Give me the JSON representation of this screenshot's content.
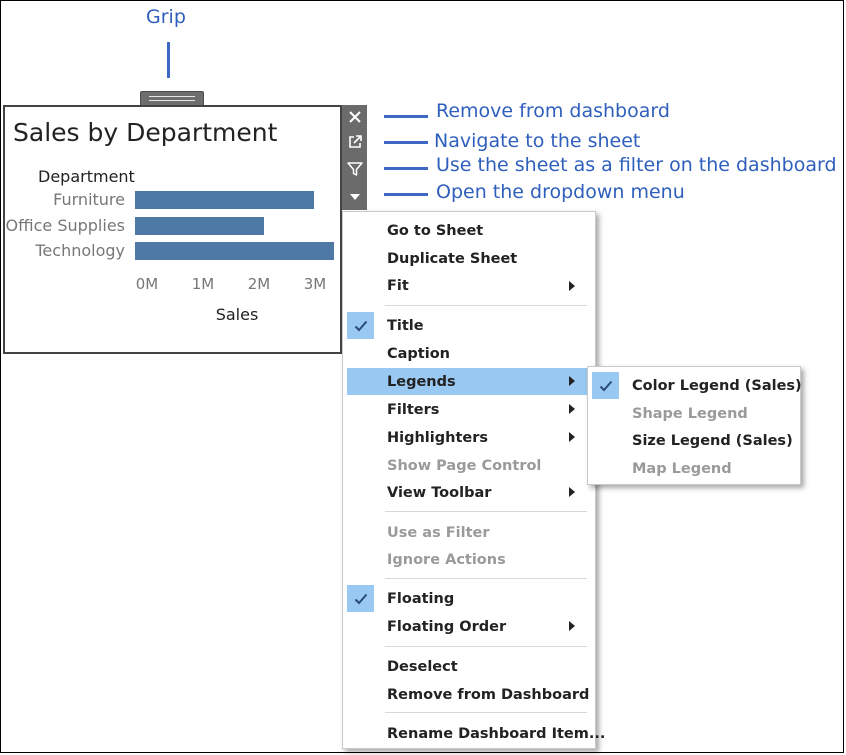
{
  "annotations": {
    "grip": "Grip",
    "remove": "Remove from dashboard",
    "navigate": "Navigate to the sheet",
    "filter": "Use the sheet as a filter on the dashboard",
    "dropdown": "Open the dropdown menu"
  },
  "sheet": {
    "title": "Sales by Department",
    "category_header": "Department",
    "xlabel": "Sales"
  },
  "chart_data": {
    "type": "bar",
    "orientation": "horizontal",
    "title": "Sales by Department",
    "categories": [
      "Furniture",
      "Office Supplies",
      "Technology"
    ],
    "values": [
      3.2,
      2.3,
      3.55
    ],
    "value_unit": "M",
    "xlabel": "Sales",
    "ylabel": "Department",
    "xlim": [
      0,
      3.55
    ],
    "xticks": [
      "0M",
      "1M",
      "2M",
      "3M"
    ],
    "bar_color": "#4e79a7"
  },
  "toolbar": {
    "icons": [
      "close-icon",
      "external-link-icon",
      "filter-icon",
      "caret-down-icon"
    ]
  },
  "menu": {
    "items": [
      {
        "label": "Go to Sheet"
      },
      {
        "label": "Duplicate Sheet"
      },
      {
        "label": "Fit"
      },
      {
        "label": "Title"
      },
      {
        "label": "Caption"
      },
      {
        "label": "Legends"
      },
      {
        "label": "Filters"
      },
      {
        "label": "Highlighters"
      },
      {
        "label": "Show Page Control"
      },
      {
        "label": "View Toolbar"
      },
      {
        "label": "Use as Filter"
      },
      {
        "label": "Ignore Actions"
      },
      {
        "label": "Floating"
      },
      {
        "label": "Floating Order"
      },
      {
        "label": "Deselect"
      },
      {
        "label": "Remove from Dashboard"
      },
      {
        "label": "Rename Dashboard Item..."
      }
    ]
  },
  "submenu": {
    "items": [
      {
        "label": "Color Legend (Sales)"
      },
      {
        "label": "Shape Legend"
      },
      {
        "label": "Size Legend (Sales)"
      },
      {
        "label": "Map Legend"
      }
    ]
  },
  "colors": {
    "annotation": "#2f5fbd",
    "highlight": "#99c9f2",
    "bar": "#4e79a7",
    "toolbar": "#6b6b6b"
  }
}
